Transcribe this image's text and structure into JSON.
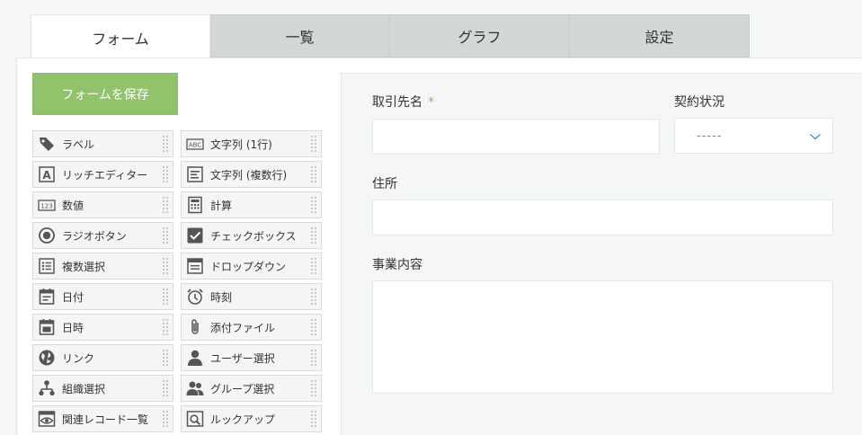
{
  "tabs": [
    {
      "label": "フォーム"
    },
    {
      "label": "一覧"
    },
    {
      "label": "グラフ"
    },
    {
      "label": "設定"
    }
  ],
  "save_button": {
    "label": "フォームを保存"
  },
  "palette": [
    {
      "label": "ラベル",
      "icon": "tag-icon"
    },
    {
      "label": "文字列 (1行)",
      "icon": "abc-text-icon"
    },
    {
      "label": "リッチエディター",
      "icon": "rich-editor-icon"
    },
    {
      "label": "文字列 (複数行)",
      "icon": "multiline-text-icon"
    },
    {
      "label": "数値",
      "icon": "number-icon"
    },
    {
      "label": "計算",
      "icon": "calculator-icon"
    },
    {
      "label": "ラジオボタン",
      "icon": "radio-icon"
    },
    {
      "label": "チェックボックス",
      "icon": "checkbox-icon"
    },
    {
      "label": "複数選択",
      "icon": "multi-select-icon"
    },
    {
      "label": "ドロップダウン",
      "icon": "dropdown-icon"
    },
    {
      "label": "日付",
      "icon": "date-icon"
    },
    {
      "label": "時刻",
      "icon": "alarm-clock-icon"
    },
    {
      "label": "日時",
      "icon": "datetime-icon"
    },
    {
      "label": "添付ファイル",
      "icon": "paperclip-icon"
    },
    {
      "label": "リンク",
      "icon": "globe-icon"
    },
    {
      "label": "ユーザー選択",
      "icon": "user-icon"
    },
    {
      "label": "組織選択",
      "icon": "org-chart-icon"
    },
    {
      "label": "グループ選択",
      "icon": "group-icon"
    },
    {
      "label": "関連レコード一覧",
      "icon": "related-records-icon"
    },
    {
      "label": "ルックアップ",
      "icon": "lookup-icon"
    }
  ],
  "form": {
    "client_name": {
      "label": "取引先名",
      "required_mark": "*"
    },
    "contract_status": {
      "label": "契約状況",
      "value": "-----"
    },
    "address": {
      "label": "住所"
    },
    "business": {
      "label": "事業内容"
    }
  },
  "colors": {
    "save_button": "#91c36c",
    "required": "#e49a2a",
    "select_value": "#3498db",
    "icon": "#555555"
  }
}
